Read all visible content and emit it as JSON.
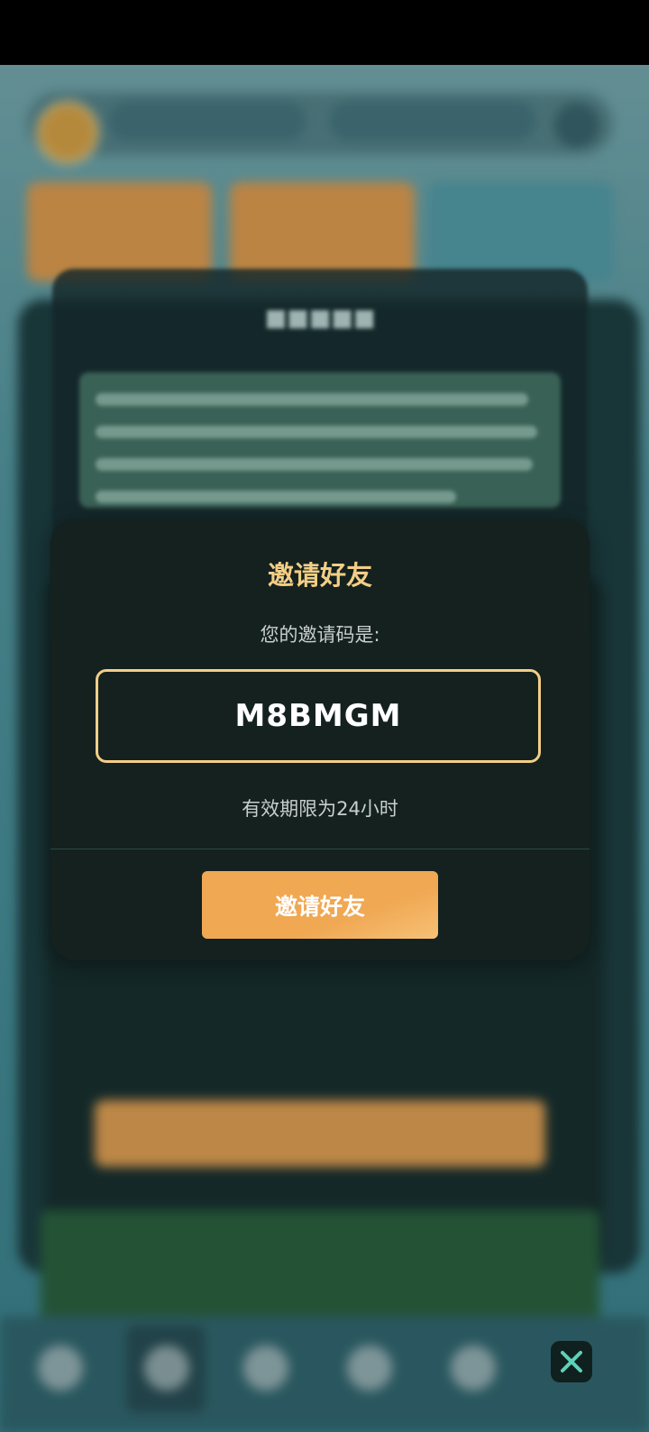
{
  "dialog": {
    "title": "邀请好友",
    "subtitle": "您的邀请码是:",
    "code": "M8BMGM",
    "validity": "有效期限为24小时",
    "button_label": "邀请好友"
  },
  "colors": {
    "accent_gold": "#f3ce86",
    "button_orange": "#f0a853",
    "dialog_bg": "#14211f"
  },
  "icons": {
    "close": "close-icon"
  }
}
